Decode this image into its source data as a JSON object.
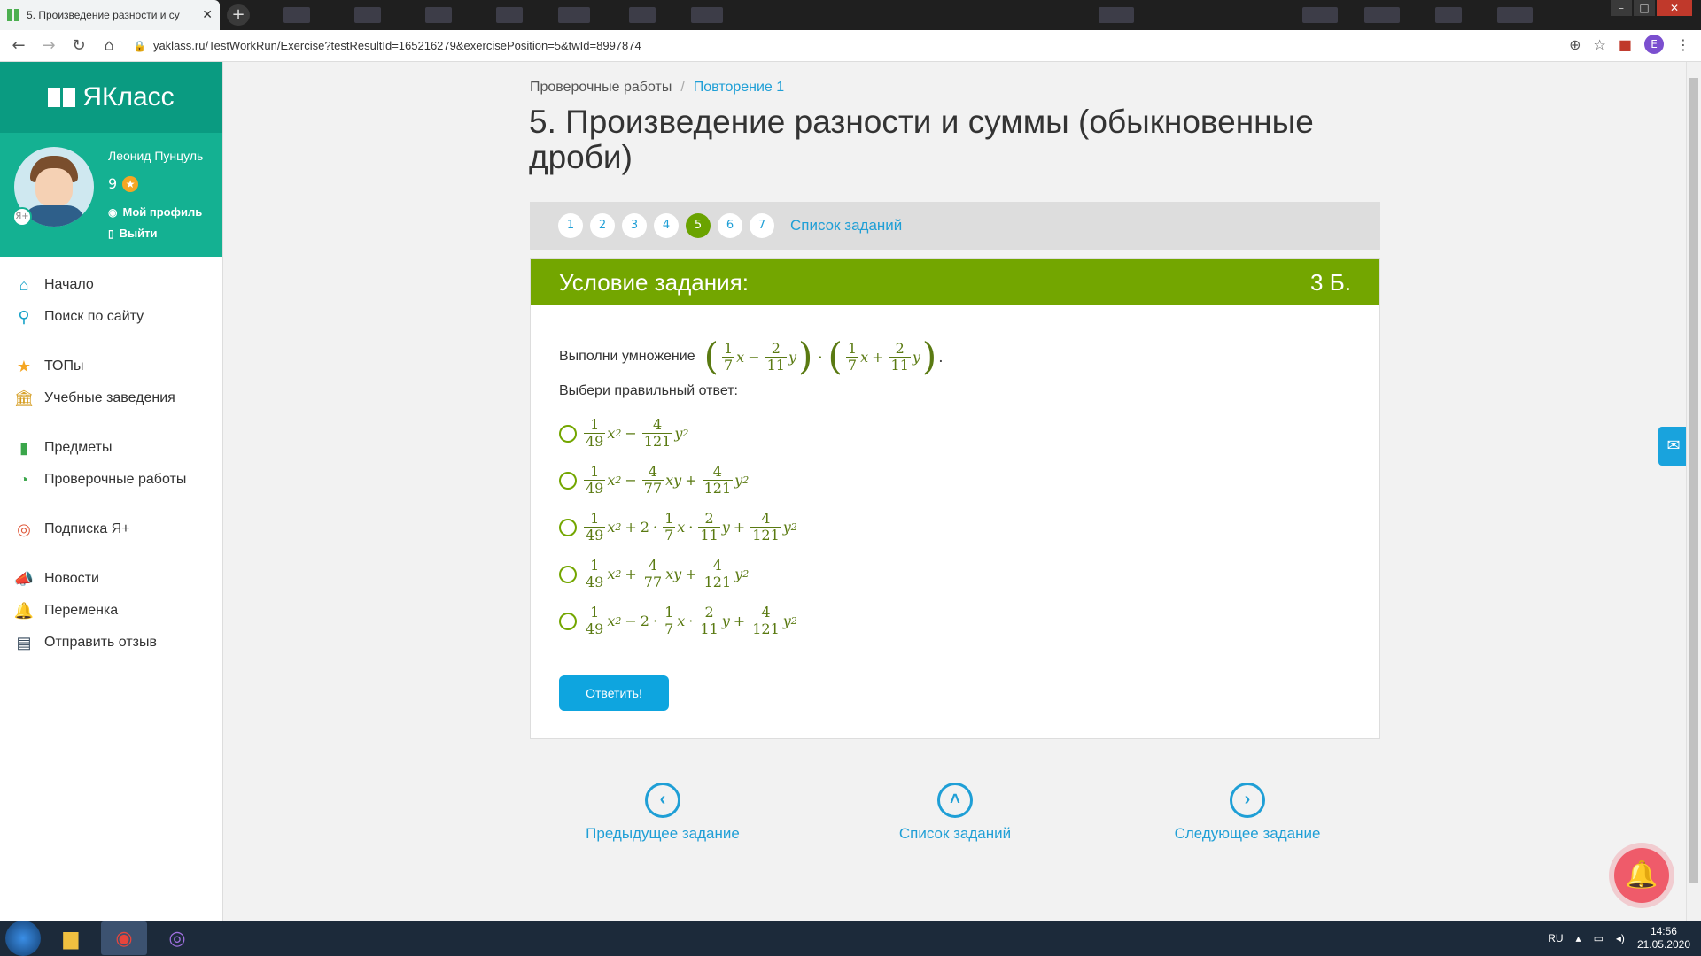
{
  "browser": {
    "tab_title": "5. Произведение разности и су",
    "url": "yaklass.ru/TestWorkRun/Exercise?testResultId=165216279&exerciseId=5&exercisePosition=5&twId=8997874",
    "url_display": "yaklass.ru/TestWorkRun/Exercise?testResultId=165216279&exercisePosition=5&twId=8997874",
    "profile_letter": "E"
  },
  "sidebar": {
    "logo": "ЯКласс",
    "user_name": "Леонид Пунцуль",
    "points": "9",
    "profile_link": "Мой профиль",
    "logout_link": "Выйти",
    "items": [
      {
        "label": "Начало",
        "icon": "home-icon"
      },
      {
        "label": "Поиск по сайту",
        "icon": "search-icon"
      },
      {
        "label": "ТОПы",
        "icon": "star-icon"
      },
      {
        "label": "Учебные заведения",
        "icon": "building-icon"
      },
      {
        "label": "Предметы",
        "icon": "books-icon"
      },
      {
        "label": "Проверочные работы",
        "icon": "tests-icon"
      },
      {
        "label": "Подписка Я+",
        "icon": "subscription-icon"
      },
      {
        "label": "Новости",
        "icon": "megaphone-icon"
      },
      {
        "label": "Переменка",
        "icon": "bell-icon"
      },
      {
        "label": "Отправить отзыв",
        "icon": "feedback-icon"
      }
    ]
  },
  "breadcrumb": {
    "root": "Проверочные работы",
    "current": "Повторение 1"
  },
  "page_title": "5. Произведение разности и суммы (обыкновенные дроби)",
  "pager": {
    "pages": [
      "1",
      "2",
      "3",
      "4",
      "5",
      "6",
      "7"
    ],
    "active": "5",
    "list_label": "Список заданий"
  },
  "task": {
    "header": "Условие задания:",
    "score": "3 Б.",
    "prompt": "Выполни умножение",
    "subprompt": "Выбери правильный ответ:",
    "answer_button": "Ответить!"
  },
  "navigation": {
    "prev": "Предыдущее задание",
    "list": "Список заданий",
    "next": "Следующее задание"
  },
  "taskbar": {
    "lang": "RU",
    "time": "14:56",
    "date": "21.05.2020"
  },
  "colors": {
    "brand_green": "#0a9b81",
    "task_header": "#73a600",
    "link_blue": "#1f9fd6",
    "button_blue": "#0ea5df"
  }
}
